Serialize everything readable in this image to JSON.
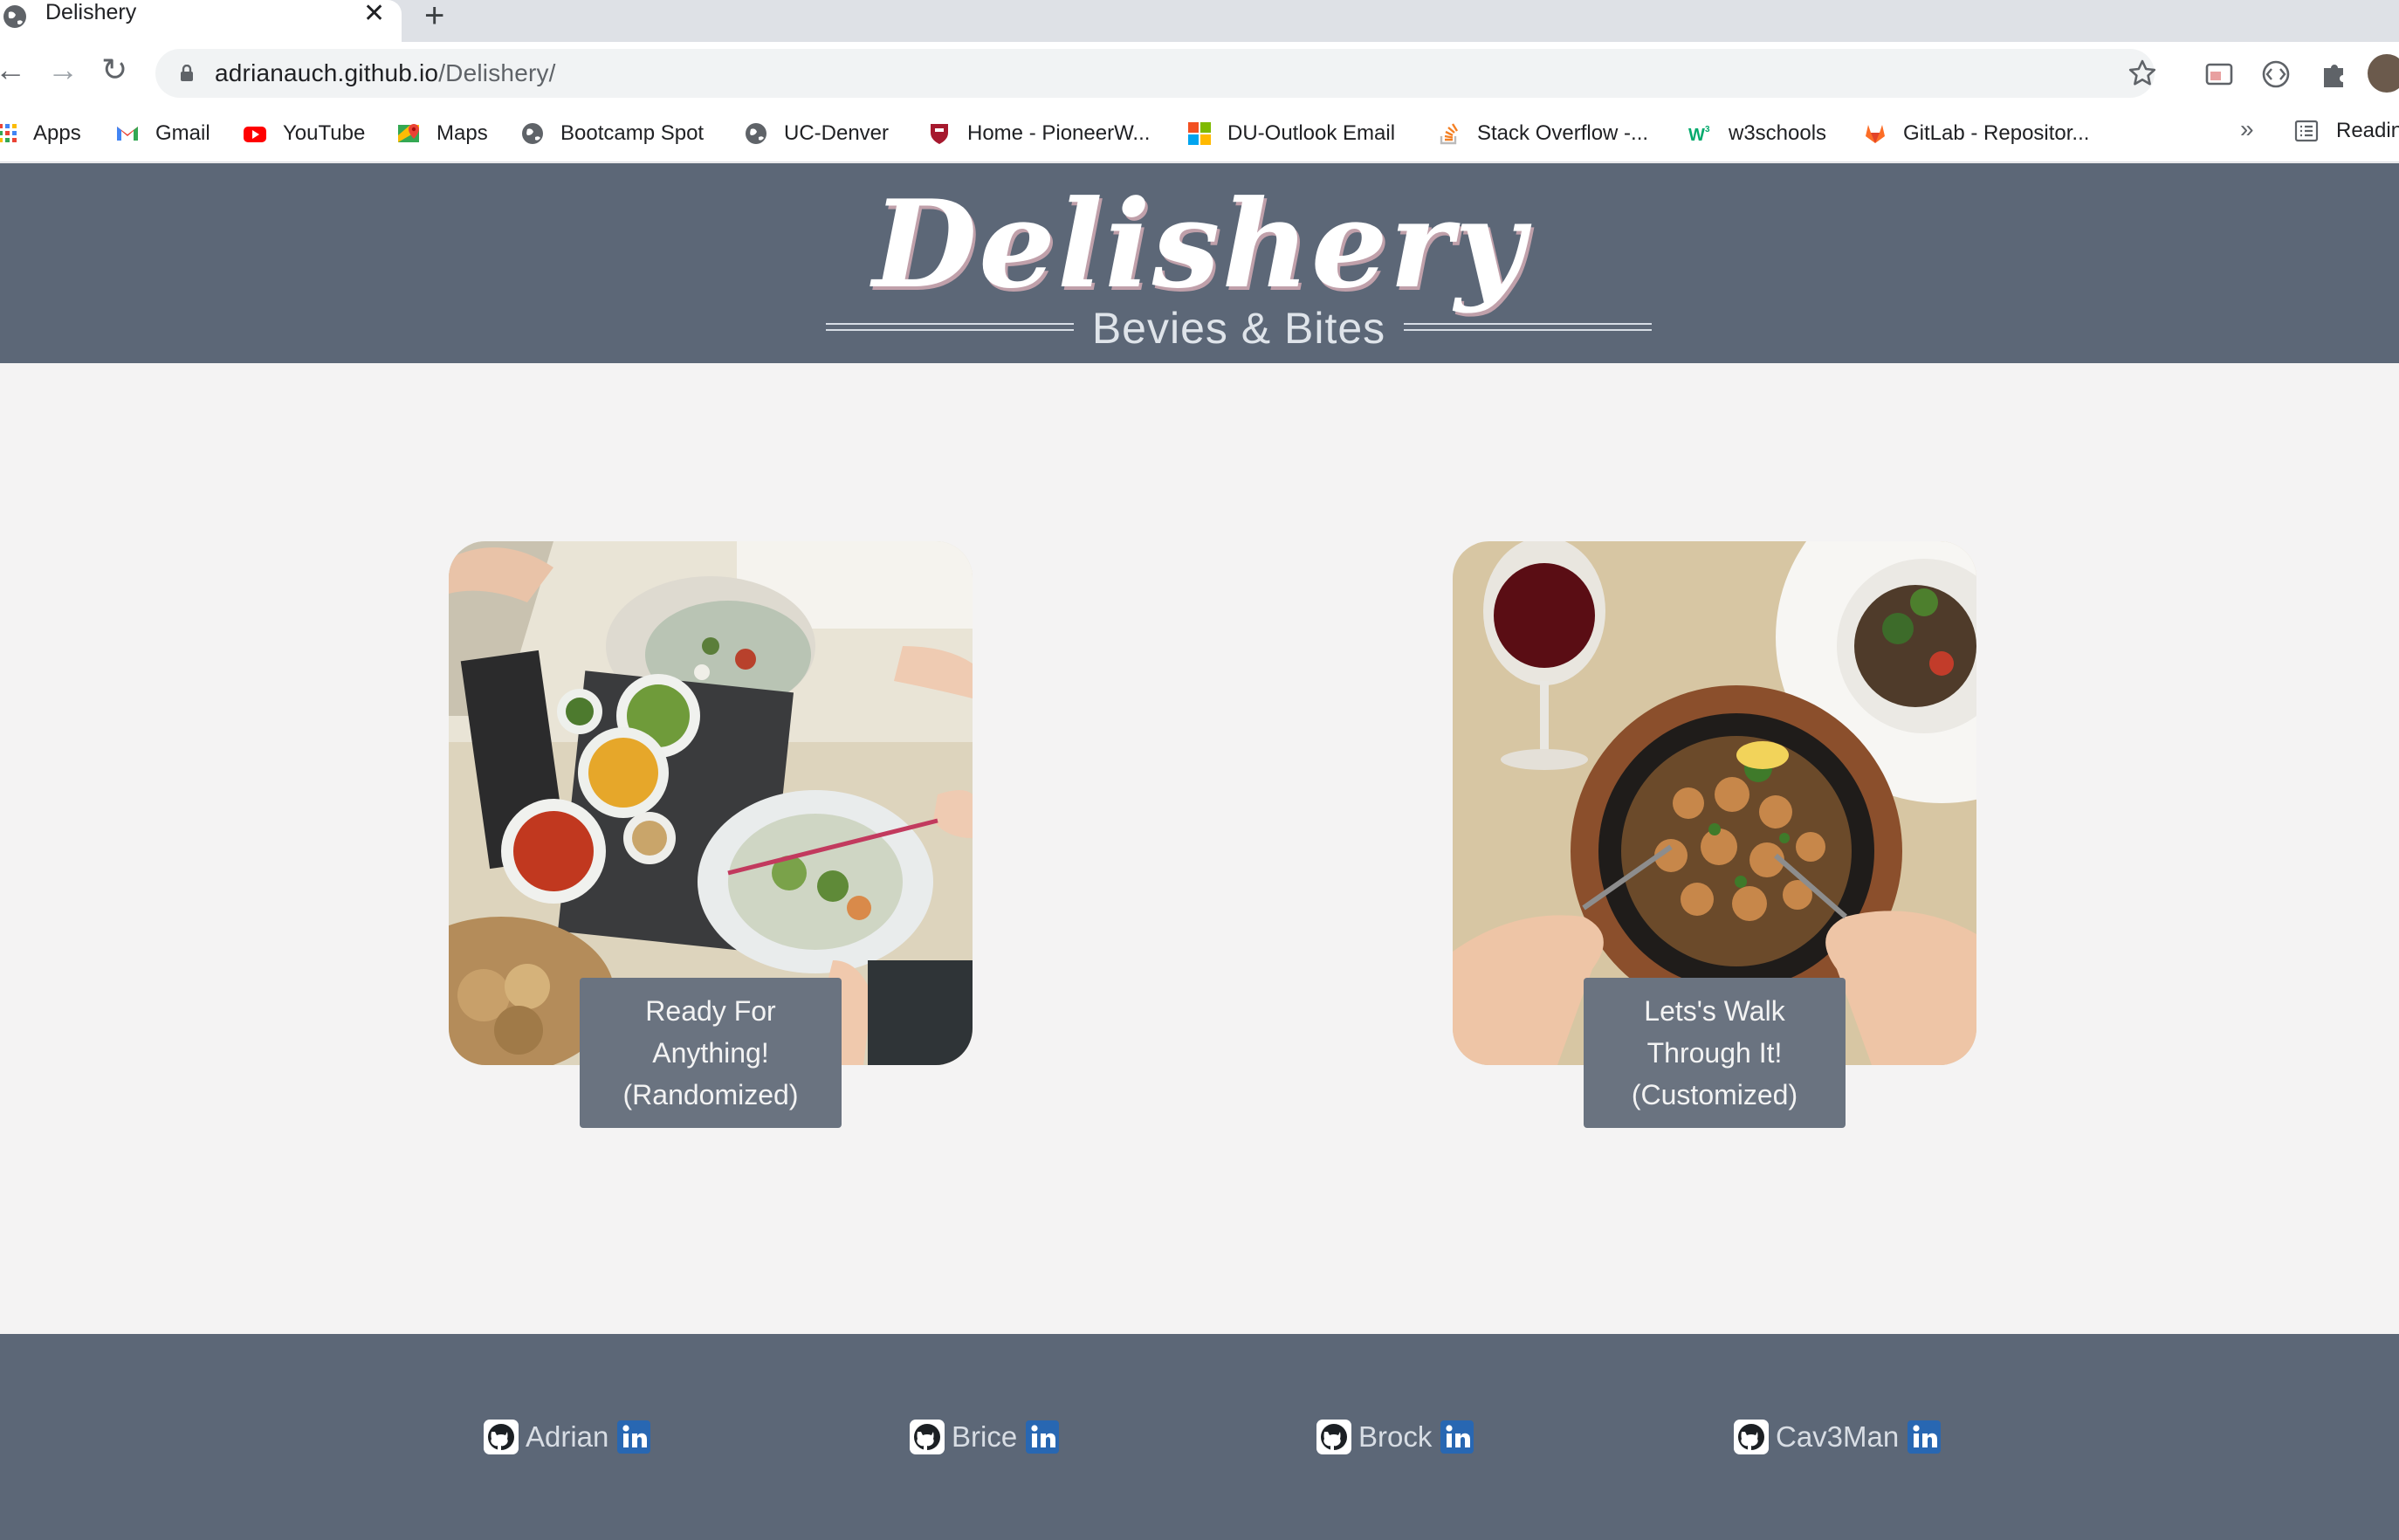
{
  "browser": {
    "tab_title": "Delishery",
    "url_host": "adrianauch.github.io",
    "url_path": "/Delishery/",
    "bookmarks": [
      {
        "label": "Apps",
        "icon": "apps-grid-icon"
      },
      {
        "label": "Gmail",
        "icon": "gmail-icon"
      },
      {
        "label": "YouTube",
        "icon": "youtube-icon"
      },
      {
        "label": "Maps",
        "icon": "maps-icon"
      },
      {
        "label": "Bootcamp Spot",
        "icon": "globe-icon"
      },
      {
        "label": "UC-Denver",
        "icon": "globe-icon"
      },
      {
        "label": "Home - PioneerW...",
        "icon": "shield-crest-icon"
      },
      {
        "label": "DU-Outlook Email",
        "icon": "microsoft-icon"
      },
      {
        "label": "Stack Overflow -...",
        "icon": "stackoverflow-icon"
      },
      {
        "label": "w3schools",
        "icon": "w3schools-icon"
      },
      {
        "label": "GitLab - Repositor...",
        "icon": "gitlab-icon"
      }
    ],
    "more_label": "»",
    "reading_list_label": "Readin"
  },
  "header": {
    "logo": "Delishery",
    "tagline": "Bevies & Bites"
  },
  "cards": [
    {
      "line1": "Ready For",
      "line2": "Anything!",
      "line3": "(Randomized)"
    },
    {
      "line1": "Lets's Walk",
      "line2": "Through It!",
      "line3": "(Customized)"
    }
  ],
  "footer": {
    "members": [
      {
        "name": "Adrian"
      },
      {
        "name": "Brice"
      },
      {
        "name": "Brock"
      },
      {
        "name": "Cav3Man"
      }
    ]
  },
  "colors": {
    "header_bg": "#5c6777",
    "page_bg": "#f4f3f3",
    "button_bg": "#6a7380",
    "linkedin_blue": "#2867b2"
  }
}
